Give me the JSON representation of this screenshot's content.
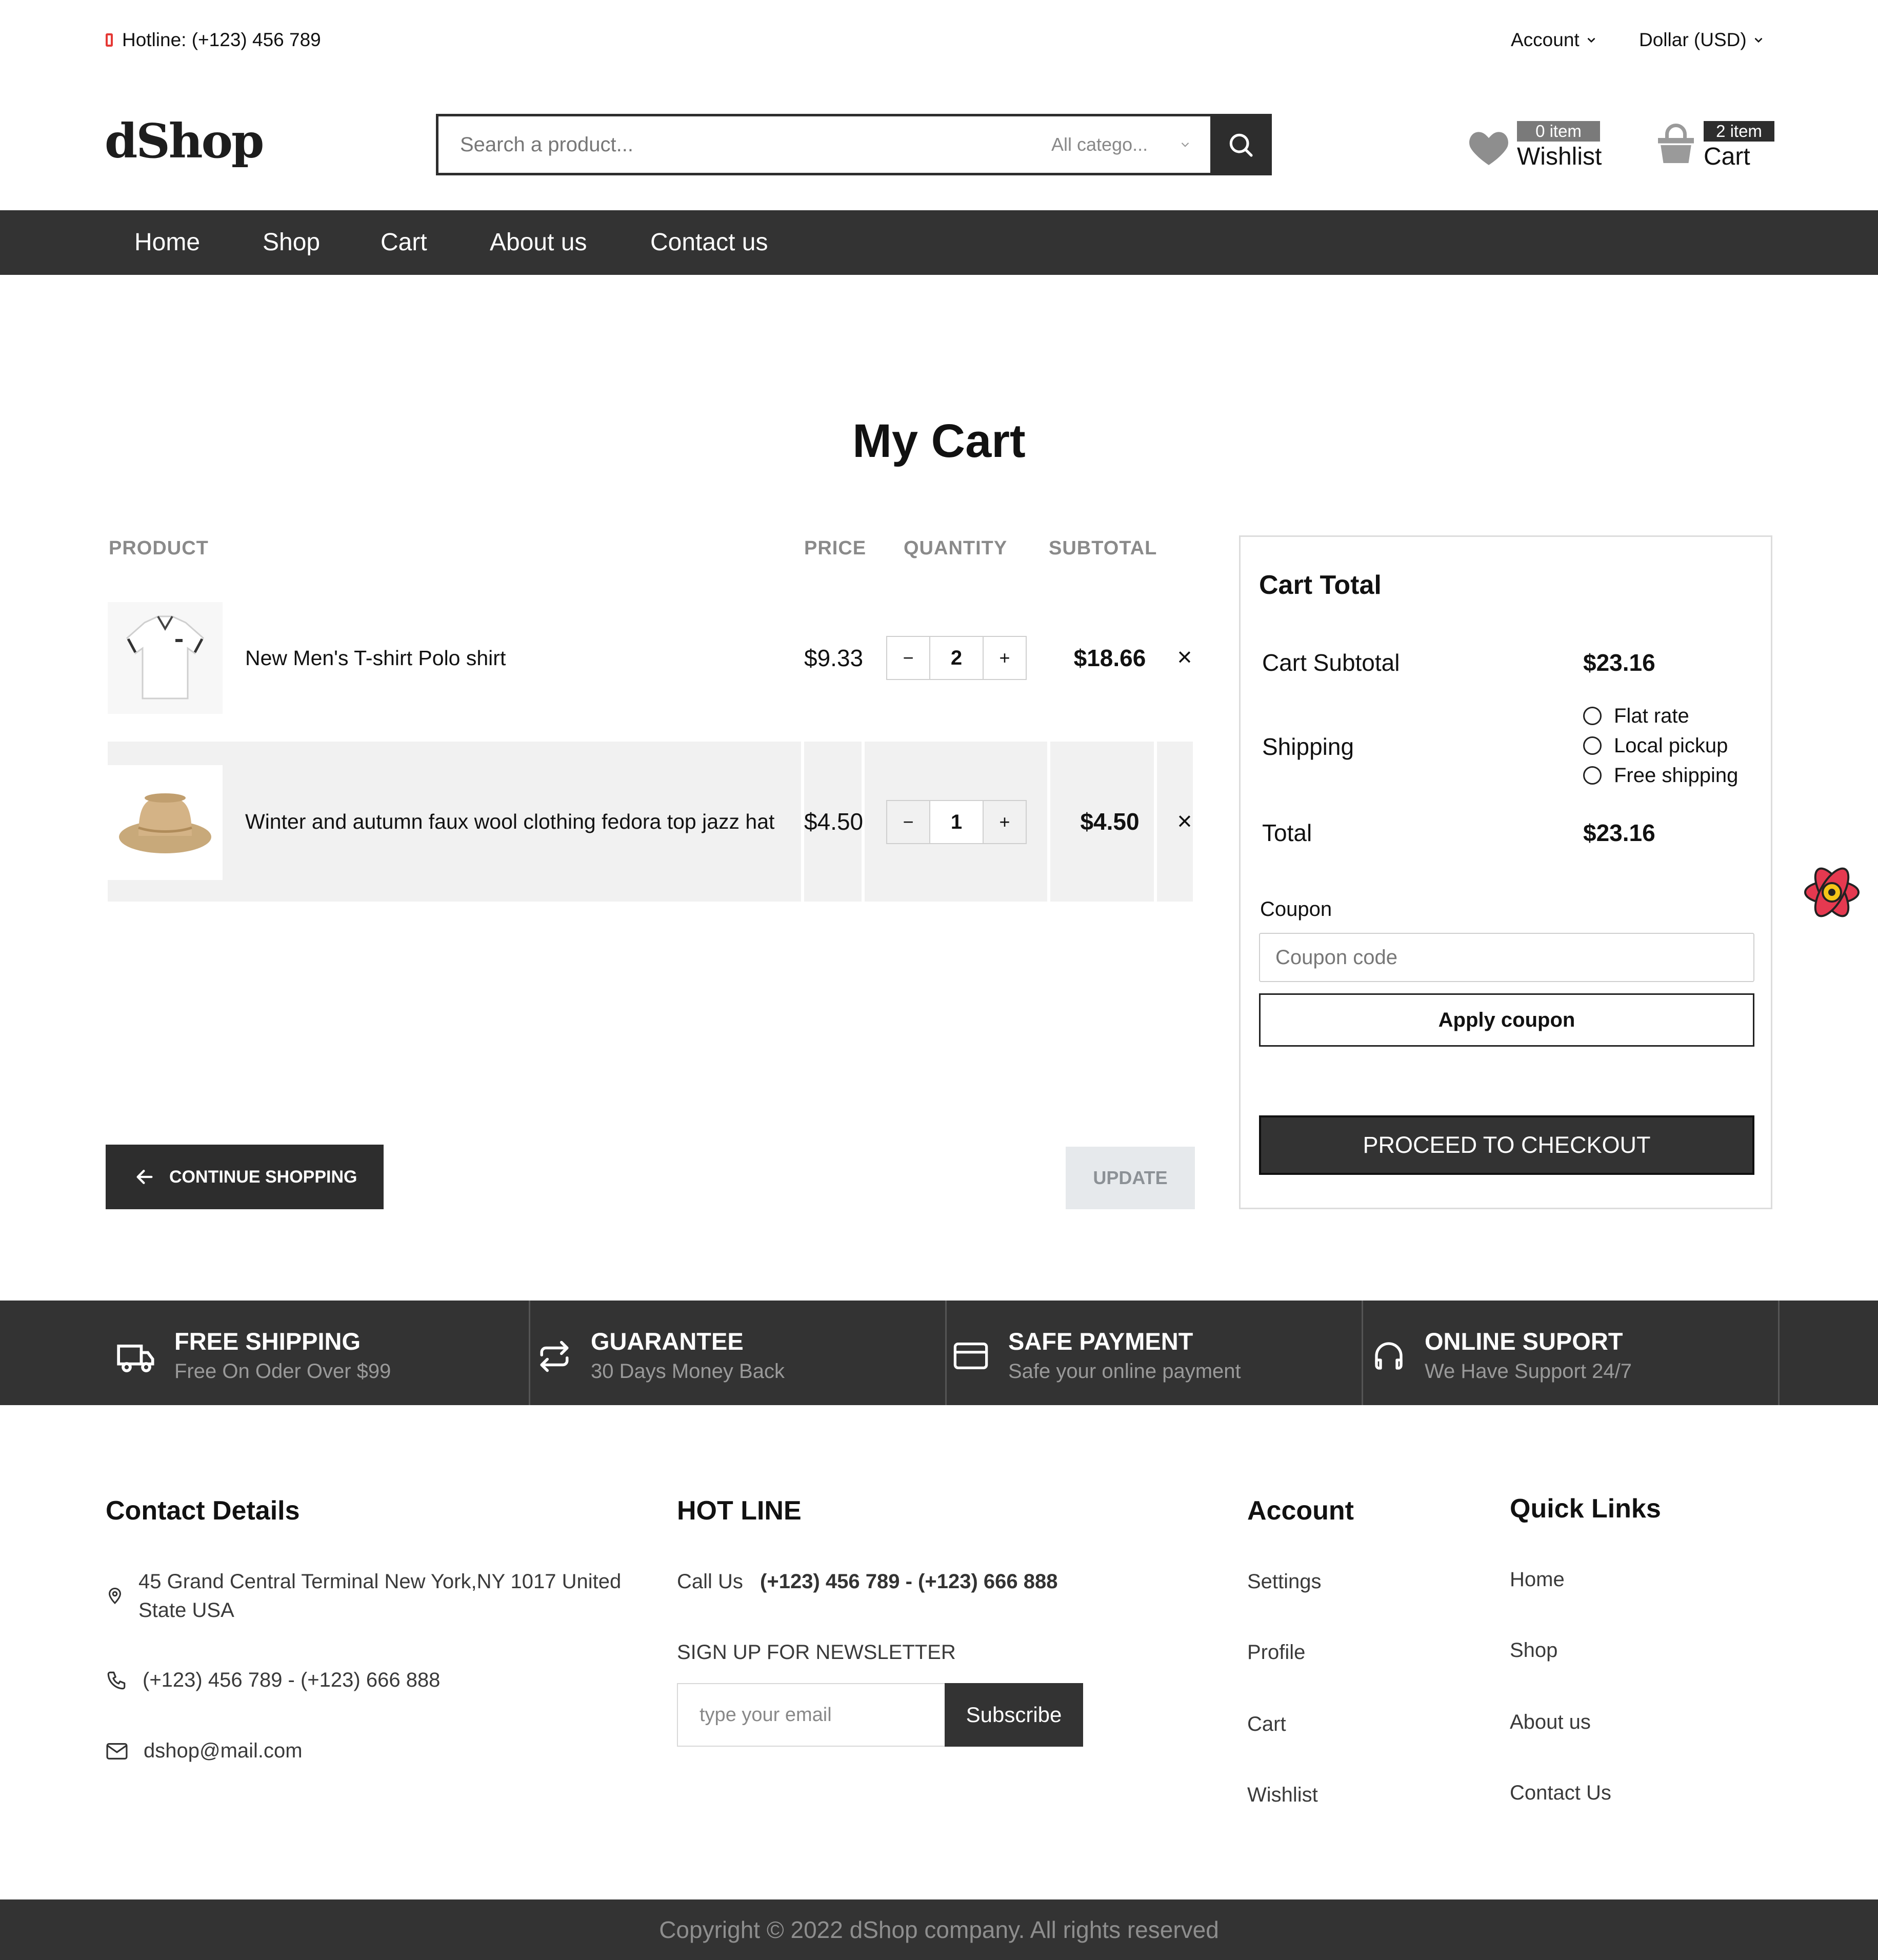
{
  "topbar": {
    "hotline": "Hotline: (+123) 456 789",
    "account": "Account",
    "currency": "Dollar (USD)"
  },
  "header": {
    "logo": "dShop",
    "search_placeholder": "Search a product...",
    "category": "All catego...",
    "wishlist_badge": "0 item",
    "wishlist_label": "Wishlist",
    "cart_badge": "2 item",
    "cart_label": "Cart"
  },
  "nav": [
    "Home",
    "Shop",
    "Cart",
    "About us",
    "Contact us"
  ],
  "page_title": "My Cart",
  "table": {
    "headers": [
      "PRODUCT",
      "PRICE",
      "QUANTITY",
      "SUBTOTAL"
    ],
    "rows": [
      {
        "name": "New Men's T-shirt Polo shirt",
        "price": "$9.33",
        "qty": "2",
        "subtotal": "$18.66"
      },
      {
        "name": "Winter and autumn faux wool clothing fedora top jazz hat",
        "price": "$4.50",
        "qty": "1",
        "subtotal": "$4.50"
      }
    ],
    "minus": "−",
    "plus": "+",
    "remove": "×"
  },
  "actions": {
    "continue": "CONTINUE SHOPPING",
    "update": "UPDATE"
  },
  "cart_total": {
    "title": "Cart Total",
    "subtotal_label": "Cart Subtotal",
    "subtotal_value": "$23.16",
    "shipping_label": "Shipping",
    "shipping_options": [
      "Flat rate",
      "Local pickup",
      "Free shipping"
    ],
    "total_label": "Total",
    "total_value": "$23.16",
    "coupon_label": "Coupon",
    "coupon_placeholder": "Coupon code",
    "apply": "Apply coupon",
    "checkout": "PROCEED TO CHECKOUT"
  },
  "features": [
    {
      "title": "FREE SHIPPING",
      "sub": "Free On Oder Over $99",
      "icon": "truck-icon"
    },
    {
      "title": "GUARANTEE",
      "sub": "30 Days Money Back",
      "icon": "repeat-icon"
    },
    {
      "title": "SAFE PAYMENT",
      "sub": "Safe your online payment",
      "icon": "credit-card-icon"
    },
    {
      "title": "ONLINE SUPORT",
      "sub": "We Have Support 24/7",
      "icon": "headphones-icon"
    }
  ],
  "footer": {
    "contact_title": "Contact Details",
    "address": "45 Grand Central Terminal New York,NY 1017 United State USA",
    "phone": "(+123) 456 789 - (+123) 666 888",
    "email": "dshop@mail.com",
    "hotline_title": "HOT LINE",
    "call_label": "Call Us",
    "call_numbers": "(+123) 456 789 - (+123) 666 888",
    "newsletter_label": "SIGN UP FOR NEWSLETTER",
    "email_placeholder": "type your email",
    "subscribe": "Subscribe",
    "account_title": "Account",
    "account_links": [
      "Settings",
      "Profile",
      "Cart",
      "Wishlist"
    ],
    "quick_title": "Quick Links",
    "quick_links": [
      "Home",
      "Shop",
      "About us",
      "Contact Us"
    ],
    "copyright": "Copyright © 2022 dShop company. All rights reserved"
  },
  "colors": {
    "dark": "#333333",
    "accent_red": "#e53935",
    "muted": "#8a8a8a"
  }
}
